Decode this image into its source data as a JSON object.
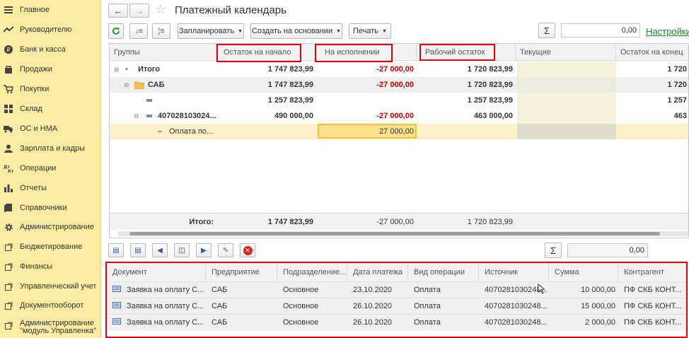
{
  "sidebar": {
    "items": [
      {
        "label": "Главное",
        "icon": "menu-icon"
      },
      {
        "label": "Руководителю",
        "icon": "trend-icon"
      },
      {
        "label": "Банк и касса",
        "icon": "coin-icon"
      },
      {
        "label": "Продажи",
        "icon": "bag-icon"
      },
      {
        "label": "Покупки",
        "icon": "cart-icon"
      },
      {
        "label": "Склад",
        "icon": "warehouse-icon"
      },
      {
        "label": "ОС и НМА",
        "icon": "truck-icon"
      },
      {
        "label": "Зарплата и кадры",
        "icon": "person-icon"
      },
      {
        "label": "Операции",
        "icon": "operations-icon"
      },
      {
        "label": "Отчеты",
        "icon": "barchart-icon"
      },
      {
        "label": "Справочники",
        "icon": "book-icon"
      },
      {
        "label": "Администрирование",
        "icon": "gear-icon"
      },
      {
        "label": "Бюджетирование",
        "icon": "link-icon"
      },
      {
        "label": "Финансы",
        "icon": "link-icon"
      },
      {
        "label": "Управленческий учет",
        "icon": "link-icon"
      },
      {
        "label": "Документооборот",
        "icon": "link-icon"
      },
      {
        "label": "Администрирование\n\"модуль Управленка\"",
        "icon": "link-icon"
      }
    ]
  },
  "header": {
    "title": "Платежный календарь",
    "settings_link": "Настройки"
  },
  "toolbar": {
    "plan_label": "Запланировать",
    "create_label": "Создать на основании",
    "print_label": "Печать",
    "sum_value": "0,00"
  },
  "grid": {
    "columns": [
      "Группы",
      "Остаток на начало",
      "На исполнении",
      "Рабочий остаток",
      "Текущие",
      "Остаток на конец"
    ],
    "rows": [
      {
        "group": "Итого",
        "start": "1 747 823,99",
        "exec": "-27 000,00",
        "work": "1 720 823,99",
        "end": "1 720"
      },
      {
        "group": "САБ",
        "start": "1 747 823,99",
        "exec": "-27 000,00",
        "work": "1 720 823,99",
        "end": "1 720"
      },
      {
        "group": "",
        "start": "1 257 823,99",
        "exec": "",
        "work": "1 257 823,99",
        "end": "1 257"
      },
      {
        "group": "407028103024...",
        "start": "490 000,00",
        "exec": "-27 000,00",
        "work": "463 000,00",
        "end": "463"
      },
      {
        "group": "Оплата по...",
        "start": "",
        "exec": "27 000,00",
        "work": "",
        "end": ""
      }
    ],
    "footer": {
      "label": "Итого:",
      "start": "1 747 823,99",
      "exec": "-27 000,00",
      "work": "1 720 823,99"
    }
  },
  "subtoolbar": {
    "sum_value": "0,00"
  },
  "docs": {
    "columns": [
      "Документ",
      "Предприятие",
      "Подразделение...",
      "Дата платежа",
      "Вид операции",
      "Источник",
      "Сумма",
      "Контрагент"
    ],
    "rows": [
      {
        "doc": "Заявка на оплату С...",
        "company": "САБ",
        "dept": "Основное",
        "date": "23.10.2020",
        "op": "Оплата",
        "source": "4070281030248...",
        "amount": "10 000,00",
        "contractor": "ПФ СКБ КОНТ..."
      },
      {
        "doc": "Заявка на оплату С...",
        "company": "САБ",
        "dept": "Основное",
        "date": "26.10.2020",
        "op": "Оплата",
        "source": "4070281030248...",
        "amount": "15 000,00",
        "contractor": "ПФ СКБ КОНТ..."
      },
      {
        "doc": "Заявка на оплату С...",
        "company": "САБ",
        "dept": "Основное",
        "date": "26.10.2020",
        "op": "Оплата",
        "source": "4070281030248...",
        "amount": "2 000,00",
        "contractor": "ПФ СКБ КОНТ..."
      }
    ]
  },
  "colors": {
    "sidebar_bg": "#fbeca1",
    "negative": "#cc0000",
    "highlight_box": "#e0000f",
    "settings_link": "#1a8a2a"
  }
}
